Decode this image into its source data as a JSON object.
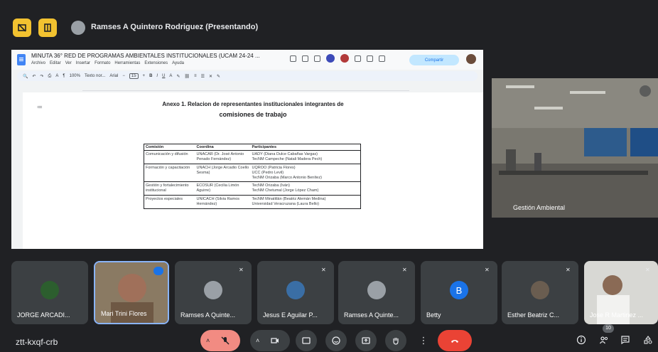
{
  "topbar": {
    "presenter": "Ramses A Quintero Rodriguez (Presentando)"
  },
  "doc": {
    "title": "MINUTA 36° RED DE PROGRAMAS AMBIENTALES INSTITUCIONALES (UCAM 24-24 ...",
    "menu": [
      "Archivo",
      "Editar",
      "Ver",
      "Insertar",
      "Formato",
      "Herramientas",
      "Extensiones",
      "Ayuda"
    ],
    "share_label": "Compartir",
    "toolbar": {
      "zoom": "100%",
      "style": "Texto nor...",
      "font": "Arial",
      "size": "15"
    },
    "annex_line1": "Anexo 1. Relacion de representantes institucionales integrantes de",
    "annex_line2": "comisiones de trabajo",
    "table": {
      "headers": [
        "Comisión",
        "Coordina",
        "Participantes"
      ],
      "rows": [
        [
          "Comunicación y difusión",
          "UNACAR (Dr. José Antonio Penado Fernández)",
          "UADY (Diana Dulce Cabañas Vargas)\nTecNM Campeche (Natali Madera Pech)"
        ],
        [
          "Formación y capacitación",
          "UNACH (Jorge Arcadio Coello Sesma)",
          "UQROO (Patricia Flores)\nUCC (Pedro Levil)\nTecNM Orizaba (Marco Antonio Benítez)"
        ],
        [
          "Gestión y fortalecimiento institucional",
          "ECOSUR (Cecilia Limón Aguirre)",
          "TecNM Orizaba (Iván)\nTecNM Chetumal (Jorge López Cham)"
        ],
        [
          "Proyectos especiales",
          "UNICACH (Silvia Ramos Hernández)",
          "TecNM Minatitlán (Beatriz Alemán Medina)\nUniversidad Veracruzana (Laura Bello)"
        ]
      ]
    }
  },
  "room_tile": {
    "name": "Gestión Ambiental"
  },
  "participants": [
    {
      "name": "JORGE ARCADI..."
    },
    {
      "name": "Mari Trini Flores"
    },
    {
      "name": "Ramses A Quinte..."
    },
    {
      "name": "Jesus E Aguilar P..."
    },
    {
      "name": "Ramses A Quinte..."
    },
    {
      "name": "Betty",
      "initial": "B"
    },
    {
      "name": "Esther Beatriz C..."
    },
    {
      "name": "Jose R Martinez ..."
    }
  ],
  "bottom": {
    "meeting_code": "ztt-kxqf-crb",
    "people_count": "10"
  },
  "colors": {
    "accent_yellow": "#f2c230",
    "end_call_red": "#ea4335",
    "speaker_ring": "#8ab4f8"
  }
}
